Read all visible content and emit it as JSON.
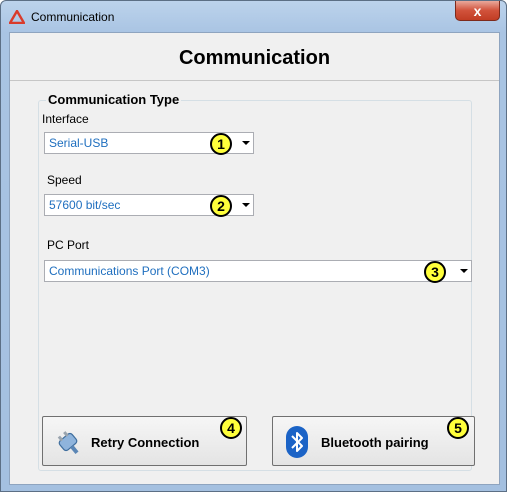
{
  "window": {
    "title": "Communication",
    "close_glyph": "x",
    "accent_color": "#d93b2b"
  },
  "header": {
    "title": "Communication"
  },
  "group": {
    "legend": "Communication Type",
    "interface": {
      "label": "Interface",
      "value": "Serial-USB",
      "badge": "1"
    },
    "speed": {
      "label": "Speed",
      "value": "57600 bit/sec",
      "badge": "2"
    },
    "pc_port": {
      "label": "PC Port",
      "value": "Communications Port (COM3)",
      "badge": "3"
    }
  },
  "buttons": {
    "retry": {
      "label": "Retry Connection",
      "badge": "4",
      "icon": "plug-icon"
    },
    "bluetooth": {
      "label": "Bluetooth pairing",
      "badge": "5",
      "icon": "bluetooth-icon"
    }
  }
}
